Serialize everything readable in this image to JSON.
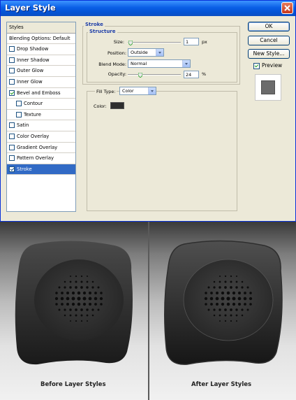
{
  "dialog": {
    "title": "Layer Style",
    "styles_header": "Styles",
    "style_items": [
      {
        "label": "Blending Options: Default",
        "checkbox": false,
        "checked": false,
        "indent": 0
      },
      {
        "label": "Drop Shadow",
        "checkbox": true,
        "checked": false,
        "indent": 0
      },
      {
        "label": "Inner Shadow",
        "checkbox": true,
        "checked": false,
        "indent": 0
      },
      {
        "label": "Outer Glow",
        "checkbox": true,
        "checked": false,
        "indent": 0
      },
      {
        "label": "Inner Glow",
        "checkbox": true,
        "checked": false,
        "indent": 0
      },
      {
        "label": "Bevel and Emboss",
        "checkbox": true,
        "checked": true,
        "indent": 0
      },
      {
        "label": "Contour",
        "checkbox": true,
        "checked": false,
        "indent": 1
      },
      {
        "label": "Texture",
        "checkbox": true,
        "checked": false,
        "indent": 1
      },
      {
        "label": "Satin",
        "checkbox": true,
        "checked": false,
        "indent": 0
      },
      {
        "label": "Color Overlay",
        "checkbox": true,
        "checked": false,
        "indent": 0
      },
      {
        "label": "Gradient Overlay",
        "checkbox": true,
        "checked": false,
        "indent": 0
      },
      {
        "label": "Pattern Overlay",
        "checkbox": true,
        "checked": false,
        "indent": 0
      },
      {
        "label": "Stroke",
        "checkbox": true,
        "checked": true,
        "indent": 0,
        "selected": true
      }
    ],
    "stroke": {
      "section_title": "Stroke",
      "structure_title": "Structure",
      "size_label": "Size:",
      "size_value": "1",
      "size_unit": "px",
      "size_slider_fraction": 0.02,
      "position_label": "Position:",
      "position_value": "Outside",
      "blend_mode_label": "Blend Mode:",
      "blend_mode_value": "Normal",
      "opacity_label": "Opacity:",
      "opacity_value": "24",
      "opacity_unit": "%",
      "opacity_slider_fraction": 0.24,
      "fill_type_label": "Fill Type:",
      "fill_type_value": "Color",
      "color_label": "Color:",
      "color_value": "#2e2e2e"
    },
    "buttons": {
      "ok": "OK",
      "cancel": "Cancel",
      "new_style": "New Style..."
    },
    "preview": {
      "label": "Preview",
      "checked": true
    }
  },
  "comparison": {
    "before_caption": "Before Layer Styles",
    "after_caption": "After Layer Styles"
  },
  "colors": {
    "title_bar": "#0a5fe6",
    "selection": "#316ac5",
    "dialog_bg": "#ece9d8",
    "group_title": "#1f3fa8"
  }
}
